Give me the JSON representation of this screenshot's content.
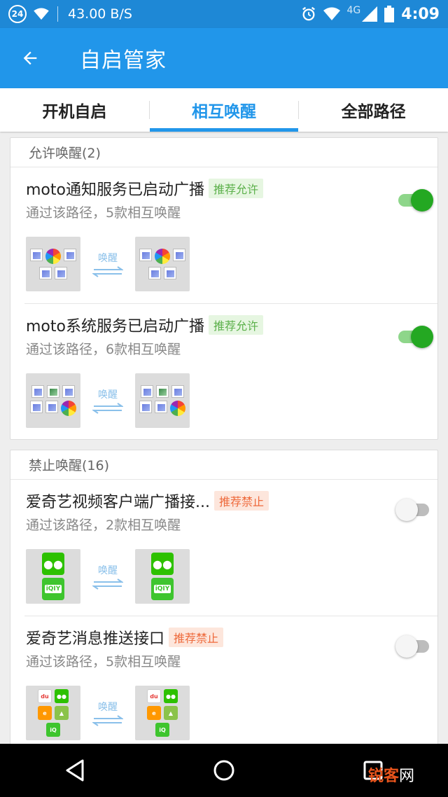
{
  "status_bar": {
    "notification_count": "24",
    "network_speed": "43.00 B/S",
    "network_type": "4G",
    "time": "4:09"
  },
  "toolbar": {
    "title": "自启管家"
  },
  "tabs": [
    {
      "label": "开机自启",
      "active": false
    },
    {
      "label": "相互唤醒",
      "active": true
    },
    {
      "label": "全部路径",
      "active": false
    }
  ],
  "allowed_section": {
    "header": "允许唤醒(2)",
    "items": [
      {
        "title": "moto通知服务已启动广播",
        "badge": "推荐允许",
        "subtitle": "通过该路径，5款相互唤醒",
        "wake_label": "唤醒",
        "enabled": true
      },
      {
        "title": "moto系统服务已启动广播",
        "badge": "推荐允许",
        "subtitle": "通过该路径，6款相互唤醒",
        "wake_label": "唤醒",
        "enabled": true
      }
    ]
  },
  "denied_section": {
    "header": "禁止唤醒(16)",
    "items": [
      {
        "title": "爱奇艺视频客户端广播接...",
        "badge": "推荐禁止",
        "subtitle": "通过该路径，2款相互唤醒",
        "wake_label": "唤醒",
        "enabled": false
      },
      {
        "title": "爱奇艺消息推送接口",
        "badge": "推荐禁止",
        "subtitle": "通过该路径，5款相互唤醒",
        "wake_label": "唤醒",
        "enabled": false
      }
    ]
  },
  "watermark": {
    "part1": "锐客",
    "part2": "网"
  },
  "colors": {
    "primary": "#2196ea",
    "toggle_on": "#24a822",
    "badge_allow": "#5bb04a",
    "badge_deny": "#ee6a3c"
  }
}
